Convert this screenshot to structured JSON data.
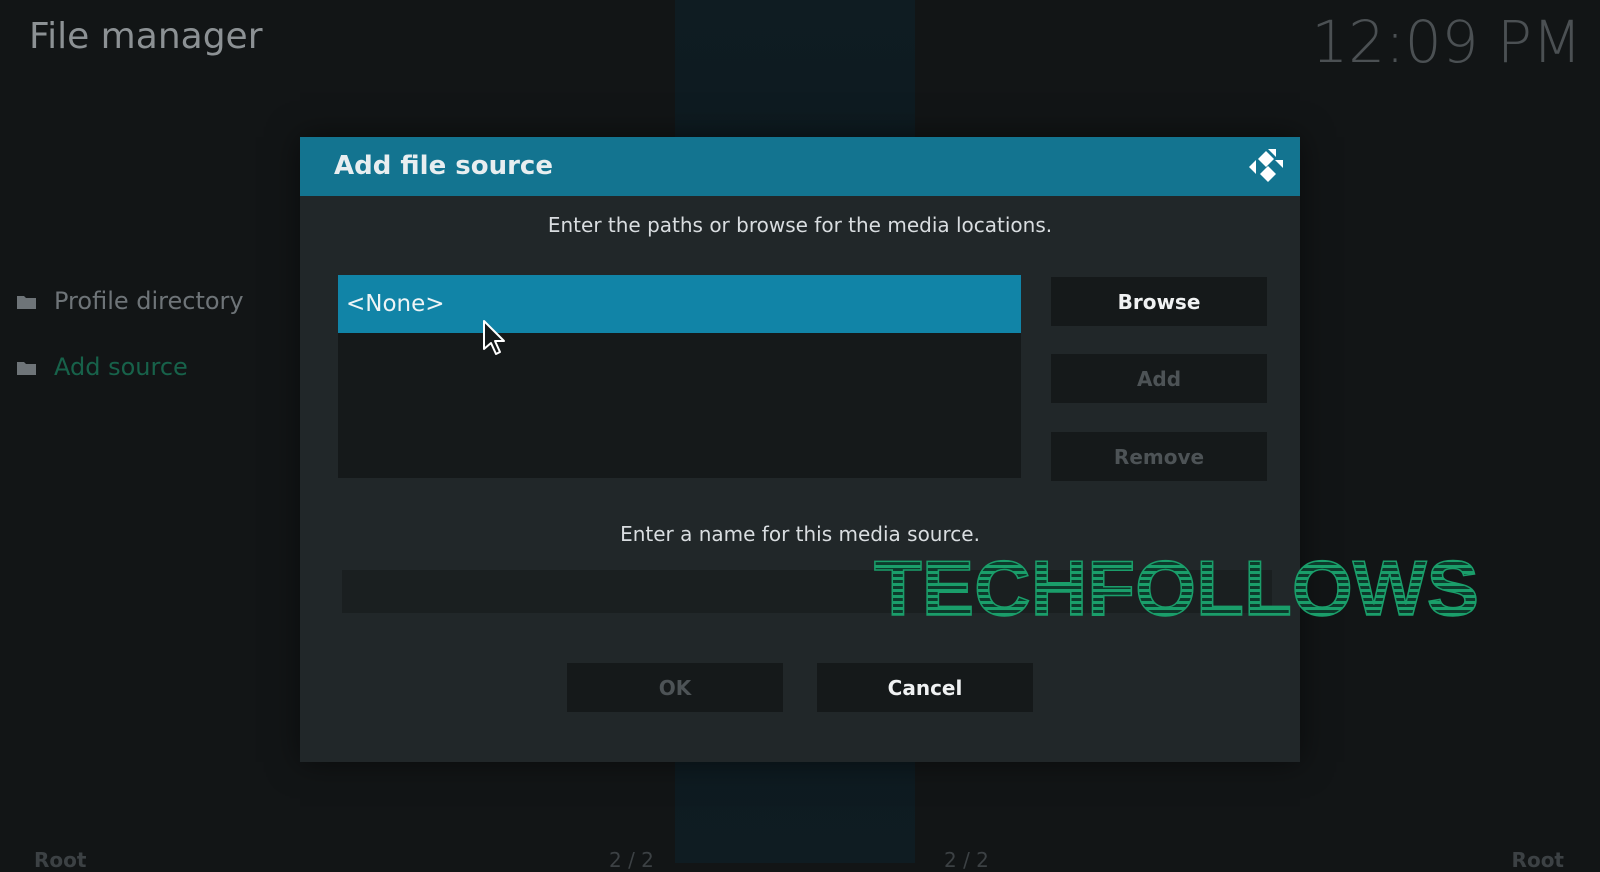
{
  "app": {
    "title": "File manager",
    "clock": "12:09 PM"
  },
  "sidebar": {
    "items": [
      {
        "label": "Profile directory",
        "icon": "folder-icon"
      },
      {
        "label": "Add source",
        "icon": "folder-icon",
        "state": "focused"
      }
    ]
  },
  "footer": {
    "left_text": "Root",
    "center_left_text": "2 / 2",
    "center_right_text": "2 / 2",
    "right_text": "Root"
  },
  "dialog": {
    "title": "Add file source",
    "logo_icon": "kodi-logo-icon",
    "paths_instruction": "Enter the paths or browse for the media locations.",
    "paths": [
      {
        "label": "<None>",
        "selected": true
      }
    ],
    "buttons": {
      "browse": "Browse",
      "add": "Add",
      "remove": "Remove",
      "ok": "OK",
      "cancel": "Cancel"
    },
    "name_instruction": "Enter a name for this media source.",
    "name_value": ""
  },
  "watermark": {
    "text": "TECHFOLLOWS"
  },
  "colors": {
    "background": "#121516",
    "dialog_bg": "#212729",
    "header": "#137490",
    "selection": "#1184a7",
    "button_bg": "#15191a",
    "focused_sidebar": "#17624a",
    "watermark": "#1a9e6a"
  }
}
